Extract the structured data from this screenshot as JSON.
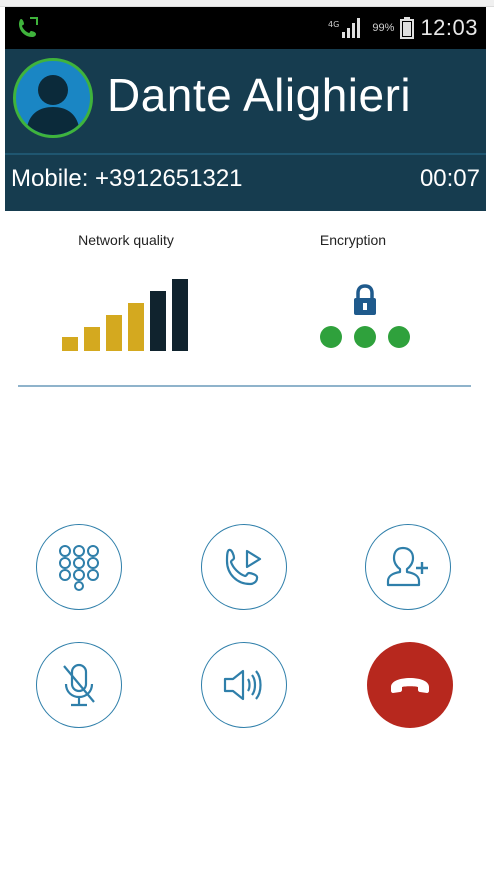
{
  "status_bar": {
    "left_icon": "phone-call-icon",
    "right_icons": [
      "signal-icon",
      "battery-icon"
    ],
    "battery_percent": "99%",
    "time": "12:03"
  },
  "caller": {
    "name": "Dante Alighieri",
    "avatar_icon": "person-silhouette-icon",
    "phone_label": "Mobile: +3912651321",
    "timer": "00:07"
  },
  "quality": {
    "network_label": "Network quality",
    "network_level": 6,
    "network_max": 6,
    "encryption_label": "Encryption",
    "encryption_dots": 3
  },
  "actions": [
    {
      "name": "keypad",
      "icon": "dialpad-icon"
    },
    {
      "name": "transfer",
      "icon": "call-transfer-icon"
    },
    {
      "name": "add-participant",
      "icon": "add-user-icon"
    },
    {
      "name": "mute",
      "icon": "mic-muted-icon"
    },
    {
      "name": "speaker",
      "icon": "speaker-icon"
    },
    {
      "name": "end-call",
      "icon": "hangup-icon"
    }
  ],
  "colors": {
    "header_bg": "#163c4f",
    "avatar_ring": "#3fb33c",
    "bar_gold": "#d4a91f",
    "bar_dark": "#10232e",
    "lock_blue": "#1f5a8c",
    "dot_green": "#2fa13c",
    "button_stroke": "#2f7faa",
    "end_call_red": "#b7281e"
  }
}
